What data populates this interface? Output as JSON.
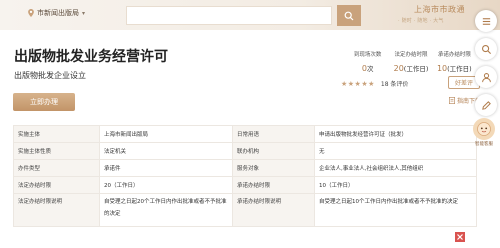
{
  "header": {
    "location": "市新闻出版局",
    "brand_name": "上海市市政通",
    "brand_tagline": "· 随时 · 随地 · 大气"
  },
  "service": {
    "title": "出版物批发业务经营许可",
    "subtitle": "出版物批发企业设立",
    "apply_label": "立即办理"
  },
  "stats": [
    {
      "label": "到现场次数",
      "value": "0",
      "unit": "次"
    },
    {
      "label": "法定办结时限",
      "value": "20",
      "unit": "(工作日)"
    },
    {
      "label": "承诺办结时限",
      "value": "10",
      "unit": "(工作日)"
    }
  ],
  "rating": {
    "stars": "★★★★★",
    "count_text": "18 条评价",
    "evaluate_label": "好差评",
    "guide_label": "指南下载"
  },
  "details": [
    [
      "实施主体",
      "上海市新闻出版局",
      "日常用语",
      "申请出版物批发经营许可证（批发）"
    ],
    [
      "实施主体性质",
      "法定机关",
      "联办机构",
      "无"
    ],
    [
      "办件类型",
      "承诺件",
      "服务对象",
      "企业法人,事业法人,社会组织法人,其他组织"
    ],
    [
      "法定办结时限",
      "20（工作日）",
      "承诺办结时限",
      "10（工作日）"
    ],
    [
      "法定办结时限说明",
      "自受理之日起20个工作日内作出批准或者不予批准的决定",
      "承诺办结时限说明",
      "自受理之日起10个工作日内作出批准或者不予批准的决定"
    ]
  ],
  "assistant": {
    "label": "智能客服"
  },
  "colors": {
    "accent": "#c9a27c",
    "accent_dark": "#b07c4c"
  }
}
